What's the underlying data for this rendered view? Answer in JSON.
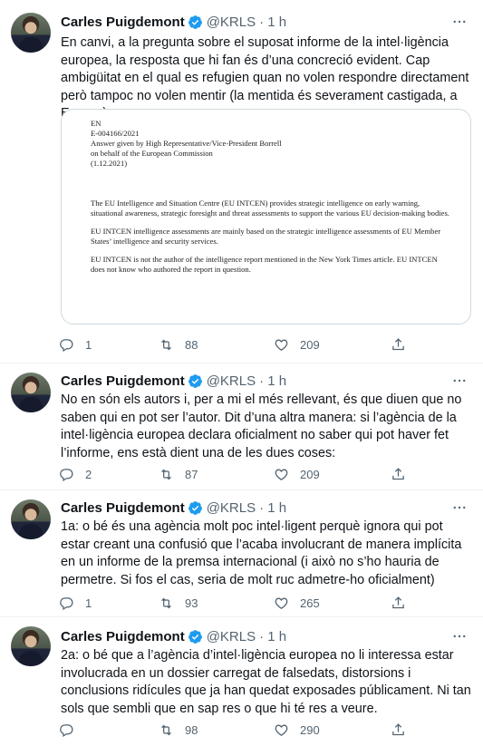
{
  "tweets": [
    {
      "name": "Carles Puigdemont",
      "handle": "@KRLS",
      "time": "· 1 h",
      "text": "En canvi, a la pregunta sobre el suposat informe de la intel·ligència europea, la resposta que hi fan és d’una concreció evident. Cap ambigüitat en el qual es refugien quan no volen respondre directament però tampoc no volen mentir (la mentida és severament castigada, a Europa)",
      "document": {
        "lines": [
          "EN",
          "E-004166/2021",
          "Answer given by High Representative/Vice-President Borrell",
          "on behalf of the European Commission",
          "(1.12.2021)"
        ],
        "paragraphs": [
          "The EU Intelligence and Situation Centre (EU INTCEN) provides strategic intelligence on early warning, situational awareness, strategic foresight and threat assessments to support the various EU decision-making bodies.",
          "EU INTCEN intelligence assessments are mainly based on the strategic intelligence assessments of EU Member States’ intelligence and security services.",
          "EU INTCEN is not the author of the intelligence report mentioned in the New York Times article. EU INTCEN does not know who authored the report in question."
        ]
      },
      "replies": "1",
      "retweets": "88",
      "likes": "209"
    },
    {
      "name": "Carles Puigdemont",
      "handle": "@KRLS",
      "time": "· 1 h",
      "text": "No en són els autors i, per a mi el més rellevant, és que diuen que no saben qui en pot ser l’autor. Dit d’una altra manera: si l’agència de la intel·ligència europea declara oficialment no saber qui pot haver fet l’informe, ens està dient una de les dues coses:",
      "replies": "2",
      "retweets": "87",
      "likes": "209"
    },
    {
      "name": "Carles Puigdemont",
      "handle": "@KRLS",
      "time": "· 1 h",
      "text": "1a: o bé és una agència molt poc intel·ligent perquè ignora qui pot estar creant una confusió que l’acaba involucrant de manera implícita en un informe de la premsa internacional (i això no s’ho hauria de permetre. Si fos el cas, seria de molt ruc admetre-ho oficialment)",
      "replies": "1",
      "retweets": "93",
      "likes": "265"
    },
    {
      "name": "Carles Puigdemont",
      "handle": "@KRLS",
      "time": "· 1 h",
      "text": "2a: o bé que a l’agència d’intel·ligència europea no li interessa estar involucrada en un dossier carregat de falsedats, distorsions i conclusions ridícules que ja han quedat exposades públicament. Ni tan sols que sembli que en sap res o que hi té res a veure.",
      "replies": "",
      "retweets": "98",
      "likes": "290"
    }
  ],
  "colors": {
    "verified": "#1d9bf0",
    "secondary": "#536471",
    "border": "#cfd9de"
  }
}
